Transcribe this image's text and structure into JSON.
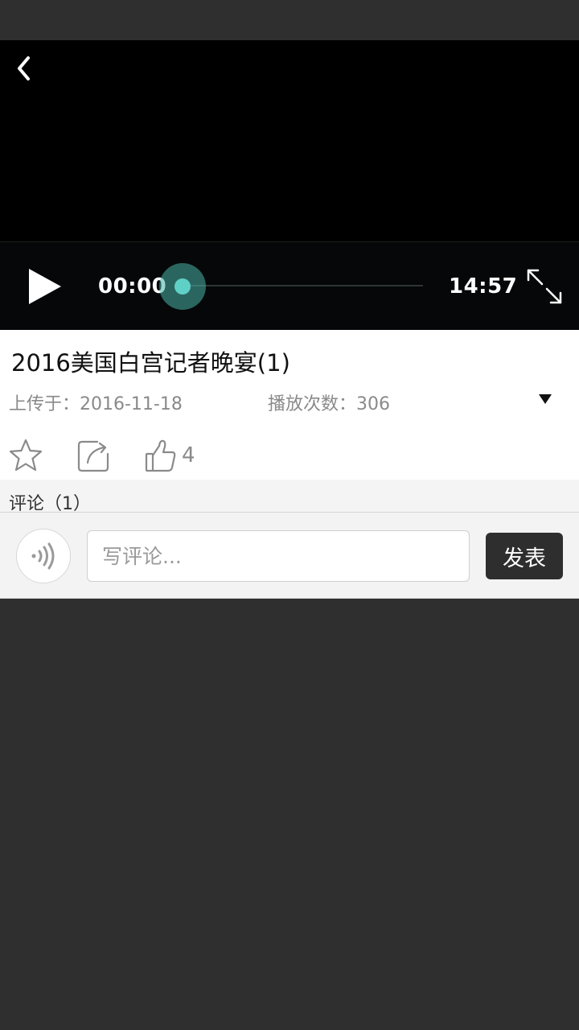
{
  "player": {
    "current_time": "00:00",
    "total_time": "14:57",
    "progress": 0.0,
    "accent_color": "#5fd0c6"
  },
  "video": {
    "title": "2016美国白宫记者晚宴(1)",
    "upload_label": "上传于：2016-11-18",
    "plays_label": "播放次数：306",
    "like_count": "4"
  },
  "comments": {
    "header": "评论（1）"
  },
  "input_bar": {
    "placeholder": "写评论...",
    "send_label": "发表"
  },
  "icons": [
    "back-icon",
    "play-icon",
    "fullscreen-icon",
    "dropdown-arrow-icon",
    "star-icon",
    "share-icon",
    "thumbs-up-icon",
    "voice-icon"
  ]
}
